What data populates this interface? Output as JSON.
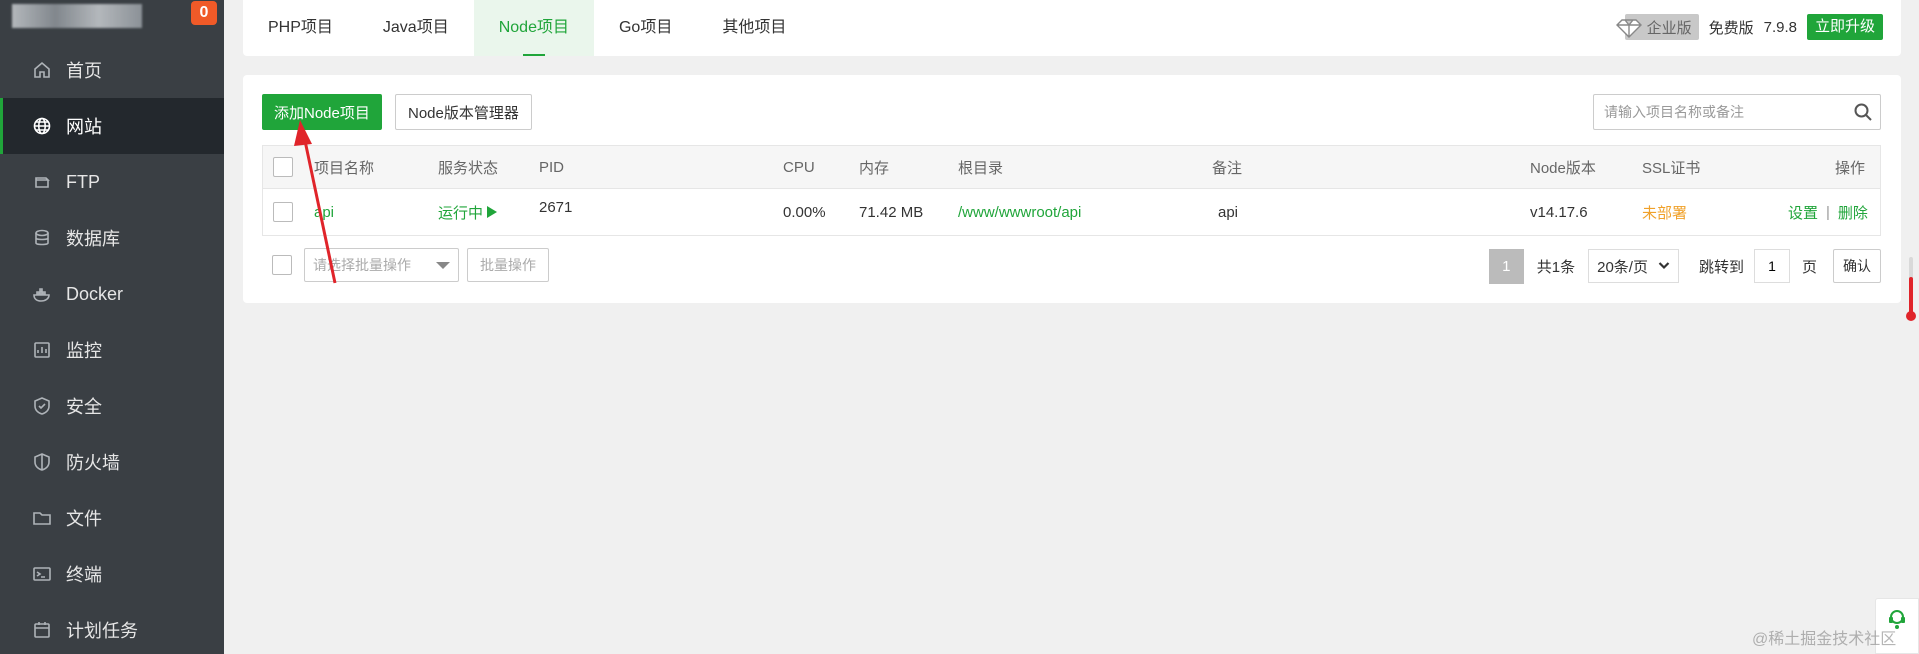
{
  "sidebar": {
    "badge": "0",
    "items": [
      {
        "label": "首页",
        "icon": "home-icon"
      },
      {
        "label": "网站",
        "icon": "globe-icon"
      },
      {
        "label": "FTP",
        "icon": "ftp-icon"
      },
      {
        "label": "数据库",
        "icon": "database-icon"
      },
      {
        "label": "Docker",
        "icon": "docker-icon"
      },
      {
        "label": "监控",
        "icon": "monitor-icon"
      },
      {
        "label": "安全",
        "icon": "shield-check-icon"
      },
      {
        "label": "防火墙",
        "icon": "shield-icon"
      },
      {
        "label": "文件",
        "icon": "folder-icon"
      },
      {
        "label": "终端",
        "icon": "terminal-icon"
      },
      {
        "label": "计划任务",
        "icon": "calendar-icon"
      }
    ]
  },
  "tabs": [
    {
      "label": "PHP项目"
    },
    {
      "label": "Java项目"
    },
    {
      "label": "Node项目"
    },
    {
      "label": "Go项目"
    },
    {
      "label": "其他项目"
    }
  ],
  "top_right": {
    "edition": "企业版",
    "free_label": "免费版",
    "version": "7.9.8",
    "upgrade_label": "立即升级"
  },
  "toolbar": {
    "add_label": "添加Node项目",
    "version_manager_label": "Node版本管理器",
    "search_placeholder": "请输入项目名称或备注"
  },
  "table": {
    "headers": {
      "name": "项目名称",
      "status": "服务状态",
      "pid": "PID",
      "cpu": "CPU",
      "mem": "内存",
      "root": "根目录",
      "remark": "备注",
      "node_version": "Node版本",
      "ssl": "SSL证书",
      "ops": "操作"
    },
    "rows": [
      {
        "name": "api",
        "status": "运行中",
        "pid": "2671",
        "cpu": "0.00%",
        "mem": "71.42 MB",
        "root": "/www/wwwroot/api",
        "remark": "api",
        "node_version": "v14.17.6",
        "ssl": "未部署",
        "op_settings": "设置",
        "op_separator": "|",
        "op_delete": "删除"
      }
    ]
  },
  "footer": {
    "batch_placeholder": "请选择批量操作",
    "batch_button": "批量操作",
    "current_page": "1",
    "total": "共1条",
    "page_size": "20条/页",
    "jump_label": "跳转到",
    "jump_value": "1",
    "page_unit": "页",
    "confirm_label": "确认"
  },
  "watermark": "@稀土掘金技术社区",
  "colors": {
    "sidebar_bg": "#3a3f44",
    "sidebar_active_bg": "#23282d",
    "accent_green": "#20a53a",
    "badge_orange": "#f05a28",
    "ssl_orange": "#f0a12a",
    "annotation_red": "#e0242a"
  }
}
